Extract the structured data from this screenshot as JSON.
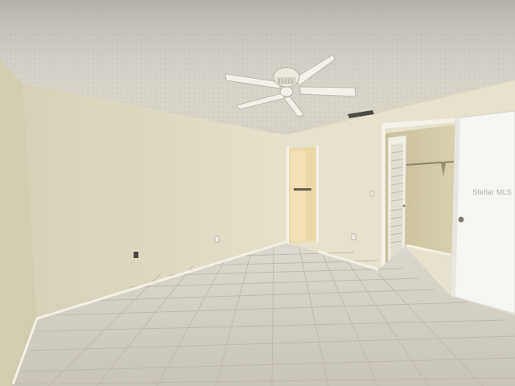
{
  "photo": {
    "subject": "empty-bedroom-interior",
    "features": [
      "ceiling-fan",
      "textured-ceiling",
      "tile-floor",
      "hallway-doorway",
      "walk-in-closet-open-door",
      "air-vent",
      "wall-outlets",
      "baseboards"
    ]
  },
  "colors": {
    "ceiling": "#d3cfc3",
    "left_wall": "#d9d3ba",
    "back_wall": "#e7e3cf",
    "right_wall": "#e2dfcb",
    "floor": "#cdc8bd",
    "door": "#f4f4f0",
    "baseboard": "#f2f0e6"
  },
  "watermark": {
    "text": "Stellar MLS"
  }
}
